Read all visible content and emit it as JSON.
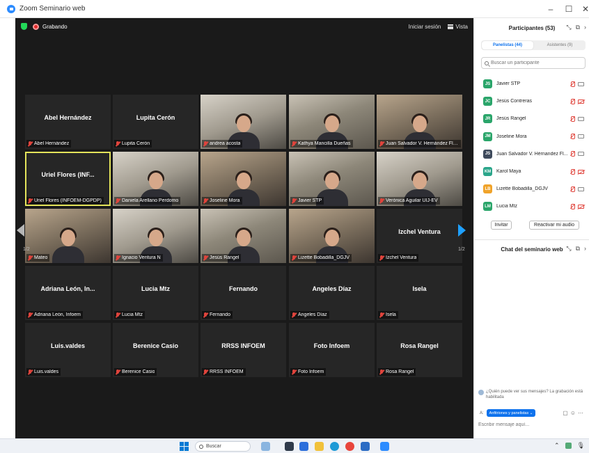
{
  "window": {
    "title": "Zoom Seminario web"
  },
  "meeting": {
    "recording_label": "Grabando",
    "signin_label": "Iniciar sesión",
    "view_label": "Vista",
    "page_left": "1/2",
    "page_right": "1/2",
    "tiles": [
      {
        "big": "Abel Hernández",
        "label": "Abel Hernández"
      },
      {
        "big": "Lupita Cerón",
        "label": "Lupita Cerón"
      },
      {
        "big": "",
        "label": "andrea acosta"
      },
      {
        "big": "",
        "label": "Kathya Mancilla Dueñas"
      },
      {
        "big": "",
        "label": "Juan Salvador V. Hernández Flor..."
      },
      {
        "big": "Uriel Flores (INF...",
        "label": "Uriel Flores (INFOEM-DGPDP)"
      },
      {
        "big": "",
        "label": "Daniela Arellano Perdomo"
      },
      {
        "big": "",
        "label": "Joseline Mora"
      },
      {
        "big": "",
        "label": "Javier STP"
      },
      {
        "big": "",
        "label": "Verónica Aguilar UIJ-EV"
      },
      {
        "big": "",
        "label": "Mateo"
      },
      {
        "big": "",
        "label": "Ignacio Ventura N"
      },
      {
        "big": "",
        "label": "Jesús Rangel"
      },
      {
        "big": "",
        "label": "Lizette Bobadilla_DGJV"
      },
      {
        "big": "Izchel Ventura",
        "label": "Izchel Ventura"
      },
      {
        "big": "Adriana León, In...",
        "label": "Adriana León, Infoem"
      },
      {
        "big": "Lucia Mtz",
        "label": "Lucia Mtz"
      },
      {
        "big": "Fernando",
        "label": "Fernando"
      },
      {
        "big": "Angeles Díaz",
        "label": "Angeles Díaz"
      },
      {
        "big": "Isela",
        "label": "Isela"
      },
      {
        "big": "Luis.valdes",
        "label": "Luis.valdes"
      },
      {
        "big": "Berenice Casio",
        "label": "Berenice Casio"
      },
      {
        "big": "RRSS INFOEM",
        "label": "RRSS INFOEM"
      },
      {
        "big": "Foto Infoem",
        "label": "Foto Infoem"
      },
      {
        "big": "Rosa Rangel",
        "label": "Rosa Rangel"
      }
    ]
  },
  "participants": {
    "title": "Participantes (53)",
    "tab_panelists": "Panelistas (44)",
    "tab_attendees": "Asistentes (9)",
    "search_placeholder": "Buscar un participante",
    "list": [
      {
        "initials": "JS",
        "name": "Javier STP",
        "color": "#2aa56a"
      },
      {
        "initials": "JC",
        "name": "Jesús Contreras",
        "color": "#2aa56a"
      },
      {
        "initials": "JR",
        "name": "Jesús Rangel",
        "color": "#2aa56a"
      },
      {
        "initials": "JM",
        "name": "Joseline Mora",
        "color": "#2aa56a"
      },
      {
        "initials": "JS",
        "name": "Juan Salvador V. Hérnandez Fl...",
        "color": "#3e4a5c"
      },
      {
        "initials": "KM",
        "name": "Karol Maya",
        "color": "#2aa58a"
      },
      {
        "initials": "LB",
        "name": "Lizette Bobadilla_DGJV",
        "color": "#f0a32a"
      },
      {
        "initials": "LM",
        "name": "Lucia Mtz",
        "color": "#2aa56a"
      }
    ],
    "invite_label": "Invitar",
    "unmute_label": "Reactivar mi audio"
  },
  "chat": {
    "title": "Chat del seminario web",
    "notice": "¿Quién puede ver sus mensajes? La grabación está habilitada",
    "to_label": "A:",
    "to_value": "Anfitriones y panelistas",
    "input_placeholder": "Escribir mensaje aquí..."
  },
  "taskbar": {
    "search_label": "Buscar"
  }
}
